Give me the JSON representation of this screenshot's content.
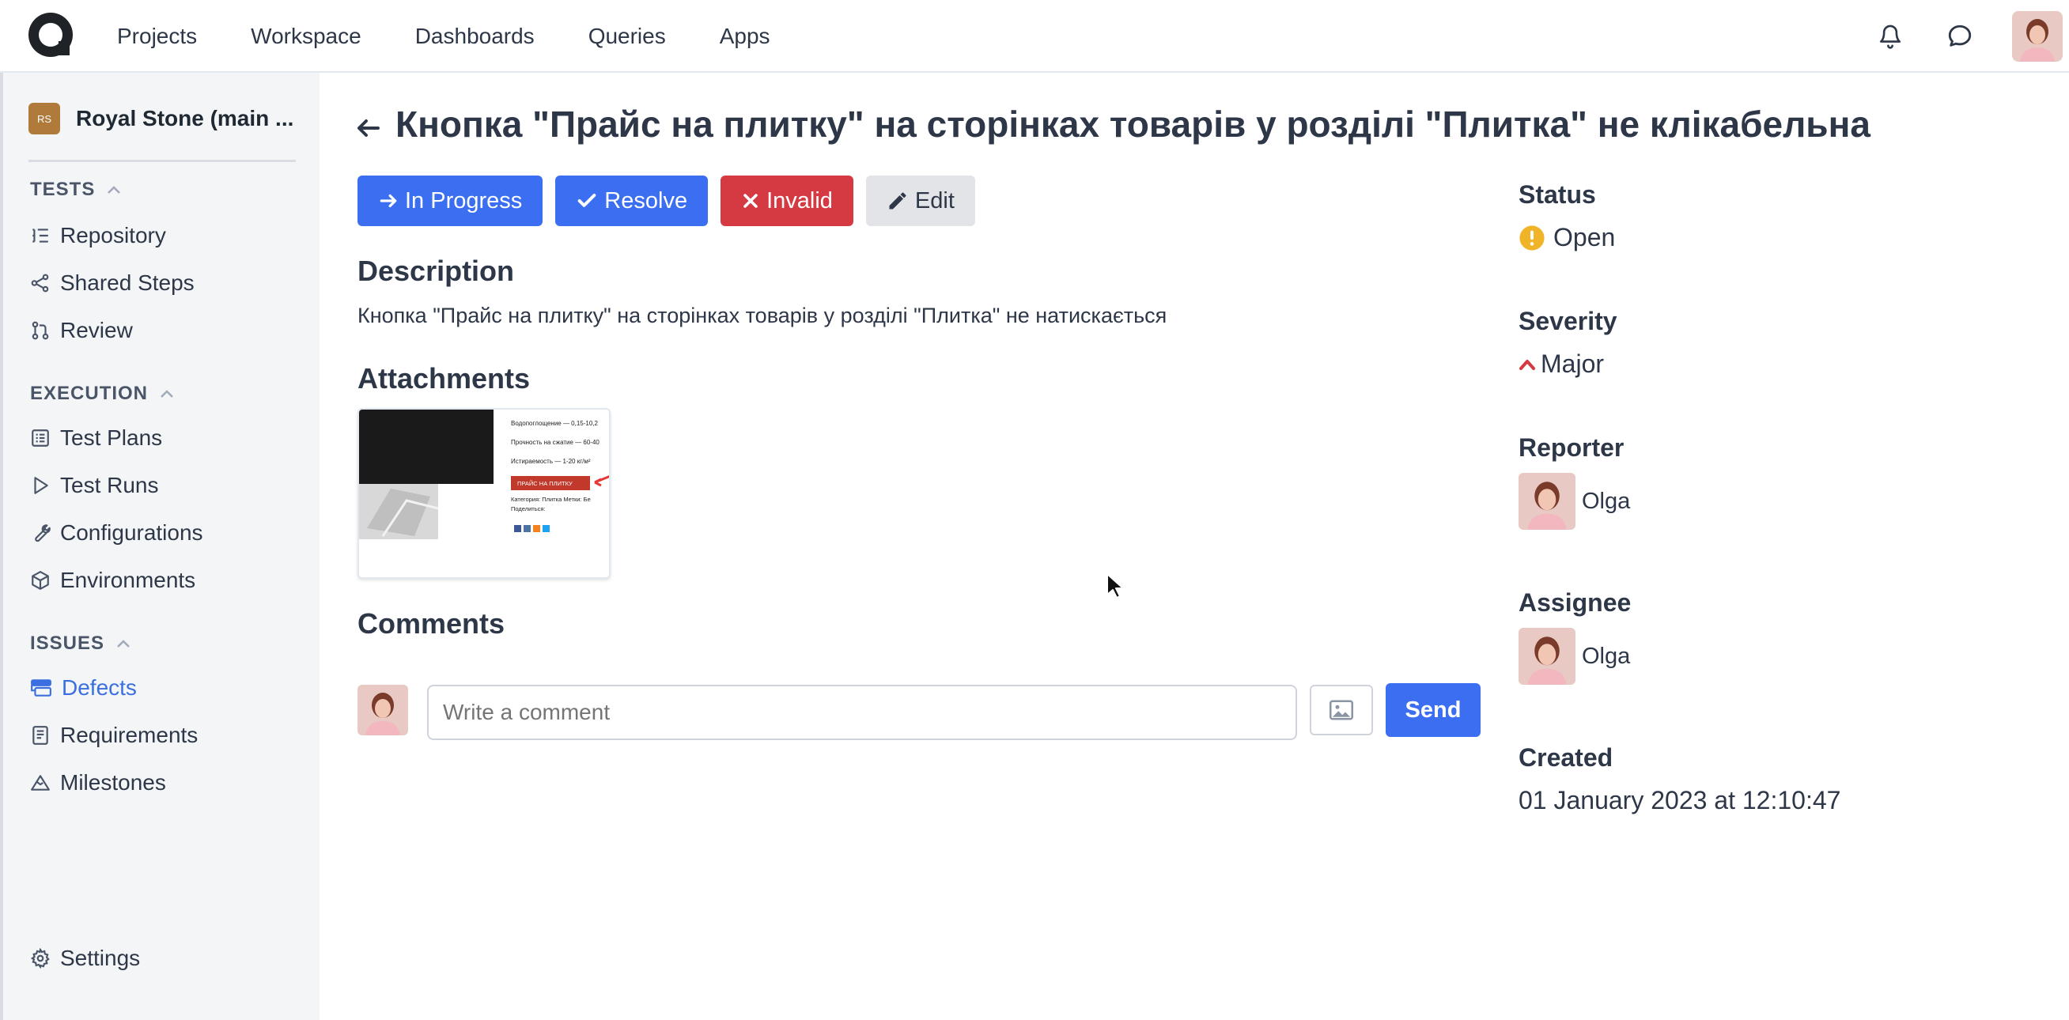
{
  "nav": {
    "links": [
      "Projects",
      "Workspace",
      "Dashboards",
      "Queries",
      "Apps"
    ]
  },
  "sidebar": {
    "project_badge": "RS",
    "project_name": "Royal Stone (main ...",
    "sections": {
      "tests": "TESTS",
      "execution": "EXECUTION",
      "issues": "ISSUES"
    },
    "items": {
      "repository": "Repository",
      "shared_steps": "Shared Steps",
      "review": "Review",
      "test_plans": "Test Plans",
      "test_runs": "Test Runs",
      "configurations": "Configurations",
      "environments": "Environments",
      "defects": "Defects",
      "requirements": "Requirements",
      "milestones": "Milestones",
      "settings": "Settings"
    }
  },
  "defect": {
    "title": "Кнопка \"Прайс на плитку\" на сторінках товарів у розділі \"Плитка\" не клікабельна",
    "actions": {
      "in_progress": "In Progress",
      "resolve": "Resolve",
      "invalid": "Invalid",
      "edit": "Edit"
    },
    "description_heading": "Description",
    "description": "Кнопка \"Прайс на плитку\" на сторінках товарів у розділі \"Плитка\" не натискається",
    "attachments_heading": "Attachments",
    "attachment_text": {
      "line1": "Водопоглощение — 0,15-10,2",
      "line2": "Прочность на сжатие — 60-40",
      "line3": "Истираемость — 1-20 кг/м²",
      "button": "ПРАЙС НА ПЛИТКУ",
      "line4": "Категория: Плитка Метки: Бе",
      "line5": "Поделиться:"
    },
    "comments_heading": "Comments",
    "comment_placeholder": "Write a comment",
    "send_label": "Send"
  },
  "details": {
    "status_label": "Status",
    "status": "Open",
    "severity_label": "Severity",
    "severity": "Major",
    "reporter_label": "Reporter",
    "reporter": "Olga",
    "assignee_label": "Assignee",
    "assignee": "Olga",
    "created_label": "Created",
    "created": "01 January 2023 at 12:10:47"
  },
  "colors": {
    "primary": "#3b6ef0",
    "danger": "#d53a43",
    "warning": "#f0b429",
    "severity_major": "#d53a43",
    "active_nav": "#3b6fe0"
  }
}
